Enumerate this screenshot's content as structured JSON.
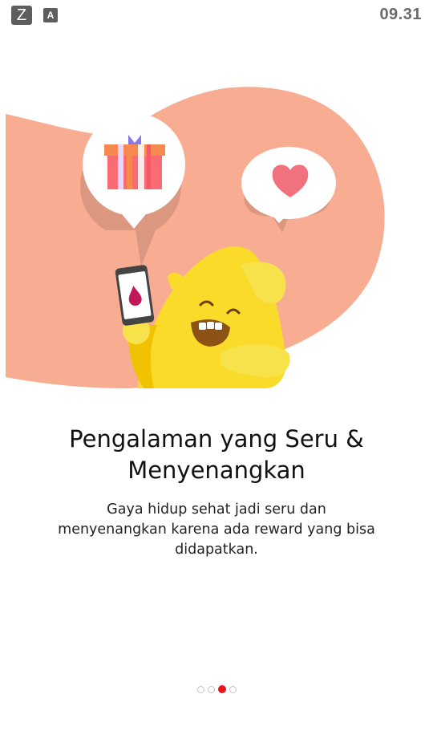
{
  "status_bar": {
    "z_icon": "Z",
    "a_icon": "A",
    "time": "09.31"
  },
  "onboarding": {
    "headline_line1": "Pengalaman yang Seru &",
    "headline_line2": "Menyenangkan",
    "subtext_line1": "Gaya hidup sehat jadi seru dan",
    "subtext_line2": "menyenangkan karena ada reward yang bisa",
    "subtext_line3": "didapatkan."
  },
  "pager": {
    "total": 4,
    "active_index": 2
  },
  "colors": {
    "blob": "#f8ad93",
    "mascot": "#fadb2a",
    "accent_red": "#e8141b",
    "heart": "#f0727e",
    "gift_red": "#f65965"
  },
  "icons": [
    "gift-icon",
    "heart-icon",
    "phone-icon",
    "blood-drop-icon",
    "mascot"
  ]
}
